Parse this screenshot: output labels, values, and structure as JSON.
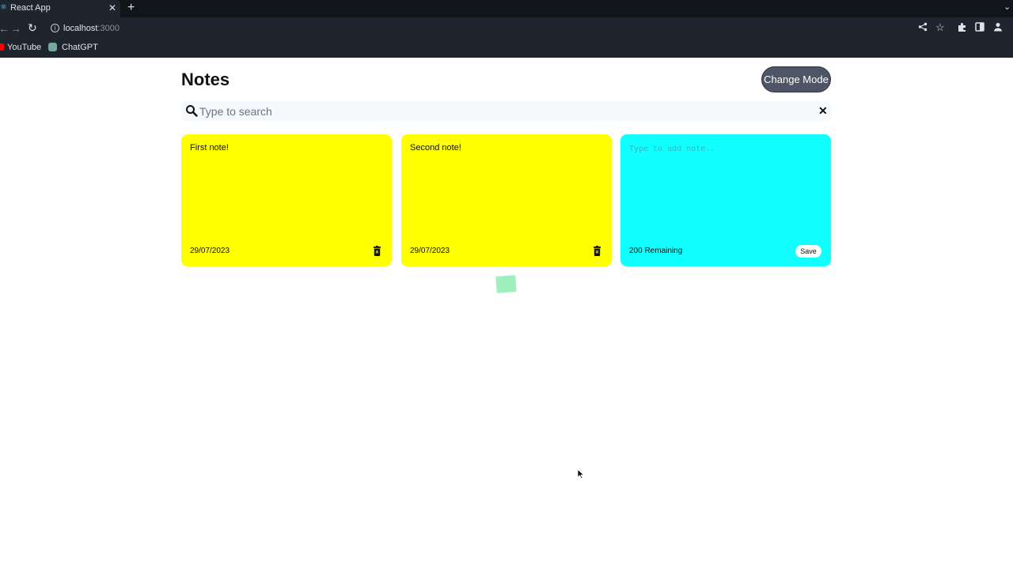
{
  "browser": {
    "tab_title": "React App",
    "tab_close": "✕",
    "new_tab": "+",
    "tab_menu": "⌄",
    "url_host": "localhost",
    "url_port": ":3000",
    "bookmarks": [
      {
        "label": "YouTube",
        "icon": "youtube-icon"
      },
      {
        "label": "ChatGPT",
        "icon": "chatgpt-icon"
      }
    ]
  },
  "app": {
    "title": "Notes",
    "change_mode_label": "Change Mode",
    "search": {
      "placeholder": "Type to search",
      "value": ""
    },
    "notes": [
      {
        "text": "First note!",
        "date": "29/07/2023",
        "color": "#ffff00"
      },
      {
        "text": "Second note!",
        "date": "29/07/2023",
        "color": "#ffff00"
      }
    ],
    "new_note": {
      "placeholder": "Type to add note..",
      "remaining": "200 Remaining",
      "save_label": "Save",
      "color": "#11ffff"
    }
  }
}
